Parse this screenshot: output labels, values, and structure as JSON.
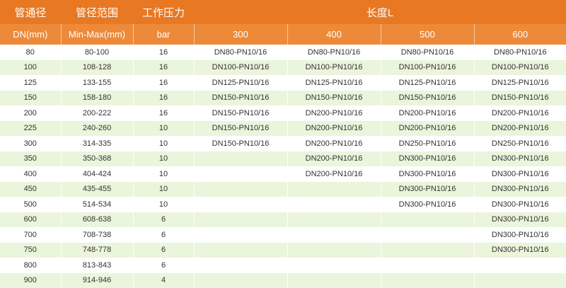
{
  "header": {
    "col_pipe": "管通径",
    "col_range": "管径范围",
    "col_pressure": "工作压力",
    "col_length": "长度L"
  },
  "subheader": {
    "dn": "DN(mm)",
    "range": "Min-Max(mm)",
    "pressure": "bar",
    "l300": "300",
    "l400": "400",
    "l500": "500",
    "l600": "600"
  },
  "rows": [
    {
      "dn": "80",
      "range": "80-100",
      "bar": "16",
      "l300": "DN80-PN10/16",
      "l400": "DN80-PN10/16",
      "l500": "DN80-PN10/16",
      "l600": "DN80-PN10/16"
    },
    {
      "dn": "100",
      "range": "108-128",
      "bar": "16",
      "l300": "DN100-PN10/16",
      "l400": "DN100-PN10/16",
      "l500": "DN100-PN10/16",
      "l600": "DN100-PN10/16"
    },
    {
      "dn": "125",
      "range": "133-155",
      "bar": "16",
      "l300": "DN125-PN10/16",
      "l400": "DN125-PN10/16",
      "l500": "DN125-PN10/16",
      "l600": "DN125-PN10/16"
    },
    {
      "dn": "150",
      "range": "158-180",
      "bar": "16",
      "l300": "DN150-PN10/16",
      "l400": "DN150-PN10/16",
      "l500": "DN150-PN10/16",
      "l600": "DN150-PN10/16"
    },
    {
      "dn": "200",
      "range": "200-222",
      "bar": "16",
      "l300": "DN150-PN10/16",
      "l400": "DN200-PN10/16",
      "l500": "DN200-PN10/16",
      "l600": "DN200-PN10/16"
    },
    {
      "dn": "225",
      "range": "240-260",
      "bar": "10",
      "l300": "DN150-PN10/16",
      "l400": "DN200-PN10/16",
      "l500": "DN200-PN10/16",
      "l600": "DN200-PN10/16"
    },
    {
      "dn": "300",
      "range": "314-335",
      "bar": "10",
      "l300": "DN150-PN10/16",
      "l400": "DN200-PN10/16",
      "l500": "DN250-PN10/16",
      "l600": "DN250-PN10/16"
    },
    {
      "dn": "350",
      "range": "350-368",
      "bar": "10",
      "l300": "",
      "l400": "DN200-PN10/16",
      "l500": "DN300-PN10/16",
      "l600": "DN300-PN10/16"
    },
    {
      "dn": "400",
      "range": "404-424",
      "bar": "10",
      "l300": "",
      "l400": "DN200-PN10/16",
      "l500": "DN300-PN10/16",
      "l600": "DN300-PN10/16"
    },
    {
      "dn": "450",
      "range": "435-455",
      "bar": "10",
      "l300": "",
      "l400": "",
      "l500": "DN300-PN10/16",
      "l600": "DN300-PN10/16"
    },
    {
      "dn": "500",
      "range": "514-534",
      "bar": "10",
      "l300": "",
      "l400": "",
      "l500": "DN300-PN10/16",
      "l600": "DN300-PN10/16"
    },
    {
      "dn": "600",
      "range": "608-638",
      "bar": "6",
      "l300": "",
      "l400": "",
      "l500": "",
      "l600": "DN300-PN10/16"
    },
    {
      "dn": "700",
      "range": "708-738",
      "bar": "6",
      "l300": "",
      "l400": "",
      "l500": "",
      "l600": "DN300-PN10/16"
    },
    {
      "dn": "750",
      "range": "748-778",
      "bar": "6",
      "l300": "",
      "l400": "",
      "l500": "",
      "l600": "DN300-PN10/16"
    },
    {
      "dn": "800",
      "range": "813-843",
      "bar": "6",
      "l300": "",
      "l400": "",
      "l500": "",
      "l600": ""
    },
    {
      "dn": "900",
      "range": "914-946",
      "bar": "4",
      "l300": "",
      "l400": "",
      "l500": "",
      "l600": ""
    }
  ],
  "colors": {
    "header_bg": "#e87822",
    "subheader_bg": "#ec8a3a",
    "stripe": "#eaf5dc"
  }
}
